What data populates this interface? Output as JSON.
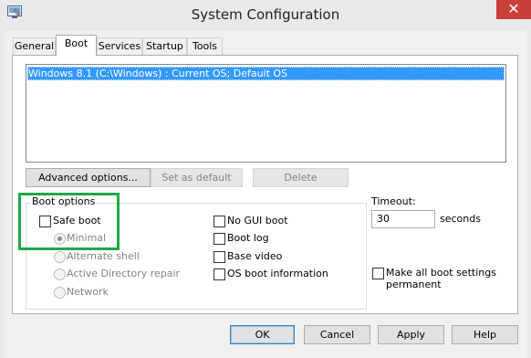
{
  "window": {
    "title": "System Configuration",
    "close_glyph": "✕",
    "icon": "msconfig-icon"
  },
  "tabs": [
    {
      "label": "General"
    },
    {
      "label": "Boot",
      "active": true
    },
    {
      "label": "Services"
    },
    {
      "label": "Startup"
    },
    {
      "label": "Tools"
    }
  ],
  "os_list": {
    "items": [
      "Windows 8.1 (C:\\Windows) : Current OS; Default OS"
    ],
    "selected_index": 0
  },
  "list_buttons": {
    "advanced": "Advanced options...",
    "set_default": "Set as default",
    "delete": "Delete"
  },
  "boot_options": {
    "group_label": "Boot options",
    "safe_boot": {
      "label": "Safe boot",
      "checked": false
    },
    "radios": [
      {
        "label": "Minimal",
        "selected": true
      },
      {
        "label": "Alternate shell",
        "selected": false
      },
      {
        "label": "Active Directory repair",
        "selected": false
      },
      {
        "label": "Network",
        "selected": false
      }
    ],
    "right_checks": [
      {
        "label": "No GUI boot",
        "checked": false
      },
      {
        "label": "Boot log",
        "checked": false
      },
      {
        "label": "Base video",
        "checked": false
      },
      {
        "label": "OS boot information",
        "checked": false
      }
    ]
  },
  "timeout": {
    "label": "Timeout:",
    "value": "30",
    "unit": "seconds"
  },
  "make_permanent": {
    "label_line1": "Make all boot settings",
    "label_line2": "permanent",
    "checked": false
  },
  "dialog_buttons": {
    "ok": "OK",
    "cancel": "Cancel",
    "apply": "Apply",
    "help": "Help"
  },
  "colors": {
    "selection": "#3399ff",
    "highlight": "#1fa84a",
    "close": "#c7413a"
  }
}
